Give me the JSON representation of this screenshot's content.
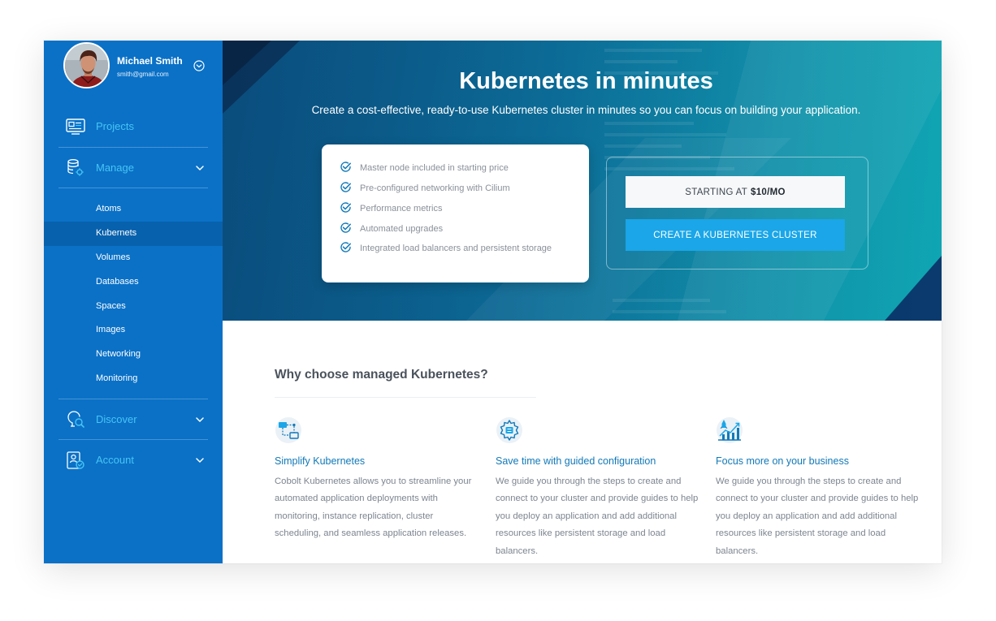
{
  "user": {
    "name": "Michael Smith",
    "email": "smith@gmail.com",
    "chevron_icon": "chevron-down-circle-icon"
  },
  "sidebar": {
    "sections": [
      {
        "label": "Projects",
        "icon": "projects-icon"
      },
      {
        "label": "Manage",
        "icon": "manage-icon"
      },
      {
        "label": "Discover",
        "icon": "discover-icon"
      },
      {
        "label": "Account",
        "icon": "account-icon"
      }
    ],
    "manage_items": [
      "Atoms",
      "Kubernets",
      "Volumes",
      "Databases",
      "Spaces",
      "Images",
      "Networking",
      "Monitoring"
    ],
    "active_item": "Kubernets"
  },
  "hero": {
    "title": "Kubernetes in minutes",
    "subtitle": "Create a cost-effective, ready-to-use Kubernetes cluster in minutes so you can focus on building your application.",
    "features": [
      "Master node included in starting price",
      "Pre-configured networking with Cilium",
      "Performance metrics",
      "Automated upgrades",
      "Integrated load balancers and persistent storage"
    ],
    "price_prefix": "STARTING AT",
    "price_value": "$10/MO",
    "cta_label": "CREATE A KUBERNETES CLUSTER"
  },
  "why": {
    "title": "Why choose managed Kubernetes?",
    "columns": [
      {
        "icon": "simplify-icon",
        "title": "Simplify Kubernetes",
        "body": "Cobolt Kubernetes allows you to streamline your automated application deployments with monitoring, instance replication, cluster scheduling, and seamless application releases."
      },
      {
        "icon": "configuration-gear-icon",
        "title": "Save time with guided configuration",
        "body": "We guide you through the steps to create and connect to your cluster and provide guides to help you deploy an application and add additional resources like persistent storage and load balancers."
      },
      {
        "icon": "business-growth-icon",
        "title": "Focus more on your business",
        "body": "We guide you through the steps to create and connect to your cluster and provide guides to help you deploy an application and add additional resources like persistent storage and load balancers."
      }
    ]
  },
  "colors": {
    "sidebar_bg": "#0a71c7",
    "sidebar_active": "#0861ad",
    "section_label": "#47c4f3",
    "cta_bg": "#1aa6e8",
    "link_blue": "#1279b8"
  }
}
